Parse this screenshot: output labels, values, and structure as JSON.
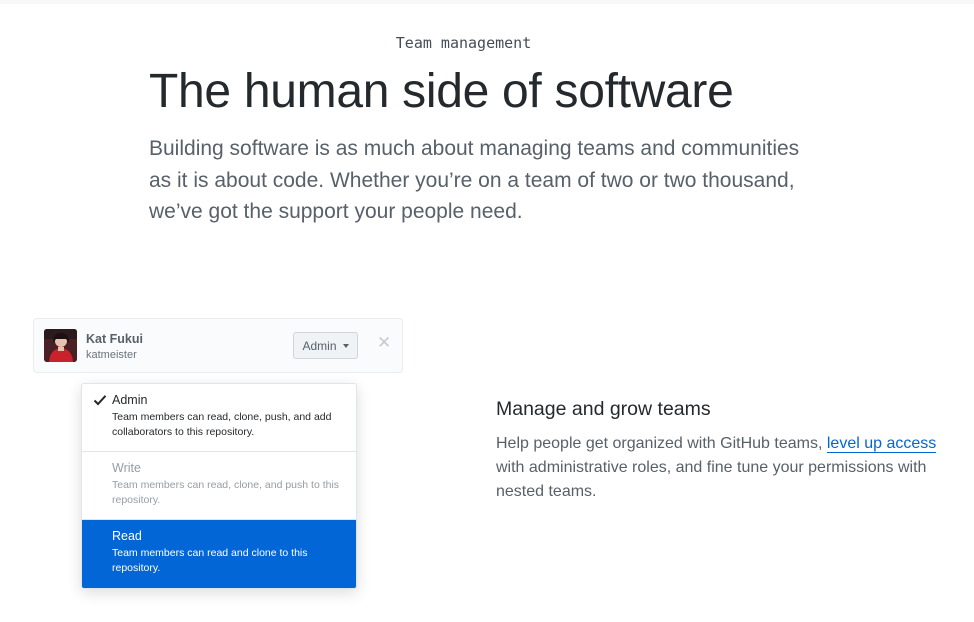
{
  "section": {
    "eyebrow": "Team management",
    "headline": "The human side of software",
    "lead": "Building software is as much about managing teams and communities as it is about code. Whether you’re on a team of two or two thousand, we’ve got the support your people need."
  },
  "member_card": {
    "name": "Kat Fukui",
    "username": "katmeister",
    "role_button": "Admin",
    "remove_icon": "close-icon"
  },
  "role_menu": {
    "options": [
      {
        "title": "Admin",
        "description": "Team members can read, clone, push, and add collaborators to this repository.",
        "checked": true
      },
      {
        "title": "Write",
        "description": "Team members can read, clone, and push to this repository.",
        "disabled": true
      },
      {
        "title": "Read",
        "description": "Team members can read and clone to this repository.",
        "highlighted": true
      }
    ]
  },
  "feature": {
    "title": "Manage and grow teams",
    "body_before": "Help people get organized with GitHub teams, ",
    "link": "level up access",
    "body_after": " with administrative roles, and fine tune your permissions with nested teams."
  },
  "colors": {
    "accent": "#0366d6",
    "text": "#24292e",
    "muted": "#586069"
  }
}
